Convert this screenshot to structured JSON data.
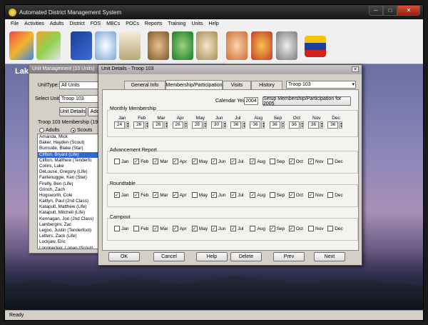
{
  "app": {
    "title": "Automated District Management System",
    "status": "Ready"
  },
  "menu": [
    "File",
    "Activities",
    "Adults",
    "District",
    "FOS",
    "MBCs",
    "POCs",
    "Reports",
    "Training",
    "Units",
    "Help"
  ],
  "desktop_title": "Lak",
  "unit_management": {
    "title": "Unit Management  (10 Units)",
    "unit_type_label": "UnitType:",
    "unit_type_value": "All Units",
    "select_unit_label": "Select Unit:",
    "select_unit_value": "Troop 103",
    "unit_details_button": "Unit Details",
    "add_button": "Add",
    "membership_label": "Troop 103 Membership  (19 adu",
    "adults_label": "Adults",
    "scouts_label": "Scouts",
    "members": [
      "Amanda,  Mick",
      "Baker,  Hayden    (Scout)",
      "Burnside,  Blake   (Star)",
      "Clifton,  Bryant   (Life)",
      "Clifton,  Matthew    (Tenderfo",
      "Colins,  Luke",
      "DeLouse,  Gregory   (Life)",
      "Fairlenuggie,  Ken   (Star)",
      "Firefly,  Ben   (Life)",
      "Grinch,  Zach",
      "Hogsworth,  Cole",
      "Kaitlyn,  Paul   (2nd Class)",
      "Katapult,  Matthew   (Life)",
      "Katapult,  Mitchell   (Life)",
      "Kennagan,  Jon    (2nd Class)",
      "Lambergini,  Zac",
      "Legoo,  Justin    (Tenderfoot)",
      "Letters,  Zack   (Life)",
      "Lockjaw,  Eric",
      "Longnecker,  Logan    (Scout)",
      "Mockery,  David    (Life)",
      "Newhouse,  Adam    (2nd Class)"
    ],
    "selected_index": 3
  },
  "unit_details": {
    "title": "Unit Details - Troop 103",
    "close": "×",
    "tabs": [
      "General Info",
      "Membership/Participation",
      "Visits",
      "History"
    ],
    "active_tab": 1,
    "unit_select": "Troop 103",
    "calendar_year_label": "Calendar Year:",
    "calendar_year": "2004",
    "setup_button": "Setup Membership/Participation for 2005",
    "monthly_membership_label": "Monthly Membership",
    "months": [
      "Jan",
      "Feb",
      "Mar",
      "Apr",
      "May",
      "Jun",
      "Jul",
      "Aug",
      "Sep",
      "Oct",
      "Nov",
      "Dec"
    ],
    "membership_values": [
      "24",
      "26",
      "26",
      "26",
      "28",
      "30",
      "36",
      "36",
      "36",
      "36",
      "36",
      "36"
    ],
    "groups": [
      {
        "label": "Advancement Report",
        "checked": [
          false,
          true,
          true,
          true,
          true,
          true,
          true,
          true,
          false,
          true,
          true,
          false
        ]
      },
      {
        "label": "Roundtable",
        "checked": [
          true,
          true,
          true,
          true,
          false,
          true,
          true,
          true,
          false,
          true,
          true,
          false
        ]
      },
      {
        "label": "Campout",
        "checked": [
          false,
          false,
          true,
          true,
          true,
          true,
          true,
          false,
          true,
          true,
          false,
          false
        ]
      }
    ],
    "buttons": [
      "OK",
      "Cancel",
      "Help",
      "Delete",
      "Prev",
      "Next"
    ]
  },
  "colors": {
    "selection": "#3368cc",
    "title_dark": "#141414"
  }
}
